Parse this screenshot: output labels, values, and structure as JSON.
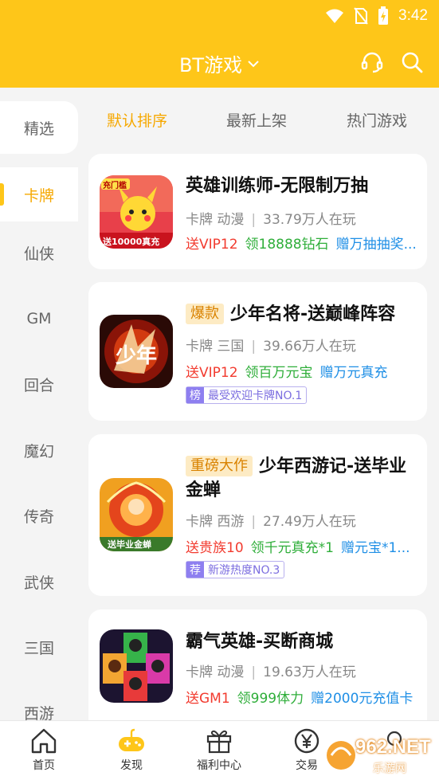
{
  "status_bar": {
    "time": "3:42"
  },
  "header": {
    "title": "BT游戏"
  },
  "sidebar": {
    "items": [
      "精选",
      "卡牌",
      "仙侠",
      "GM",
      "回合",
      "魔幻",
      "传奇",
      "武侠",
      "三国",
      "西游"
    ],
    "active": "卡牌"
  },
  "sort_tabs": [
    "默认排序",
    "最新上架",
    "热门游戏"
  ],
  "games": [
    {
      "title": "英雄训练师-无限制万抽",
      "badge": "",
      "category": "卡牌",
      "genre": "动漫",
      "players": "33.79万人在玩",
      "perks": [
        "送VIP12",
        "领18888钻石",
        "赠万抽抽奖..."
      ],
      "icon_text_top": "充门槛",
      "icon_text_bottom": "送10000真充",
      "rank_tag": "",
      "rank_text": ""
    },
    {
      "title": "少年名将-送巅峰阵容",
      "badge": "爆款",
      "category": "卡牌",
      "genre": "三国",
      "players": "39.66万人在玩",
      "perks": [
        "送VIP12",
        "领百万元宝",
        "赠万元真充"
      ],
      "icon_text_top": "",
      "icon_text_bottom": "",
      "rank_tag": "榜",
      "rank_text": "最受欢迎卡牌NO.1"
    },
    {
      "title": "少年西游记-送毕业",
      "title_line2": "金蝉",
      "badge": "重磅大作",
      "category": "卡牌",
      "genre": "西游",
      "players": "27.49万人在玩",
      "perks": [
        "送贵族10",
        "领千元真充*1",
        "赠元宝*1..."
      ],
      "icon_text_top": "",
      "icon_text_bottom": "送毕业金蝉",
      "rank_tag": "荐",
      "rank_text": "新游热度NO.3"
    },
    {
      "title": "霸气英雄-买断商城",
      "badge": "",
      "category": "卡牌",
      "genre": "动漫",
      "players": "19.63万人在玩",
      "perks": [
        "送GM1",
        "领999体力",
        "赠2000元充值卡"
      ],
      "icon_text_top": "",
      "icon_text_bottom": "",
      "rank_tag": "",
      "rank_text": ""
    }
  ],
  "bottom_nav": [
    "首页",
    "发现",
    "福利中心",
    "交易",
    ""
  ],
  "watermark": {
    "text": "962.NET",
    "sub": "乐游网"
  },
  "colors": {
    "accent": "#fec619",
    "active_text": "#f6a800",
    "perk_red": "#f23b2f",
    "perk_green": "#2fae3a",
    "perk_blue": "#1f8fe6"
  }
}
